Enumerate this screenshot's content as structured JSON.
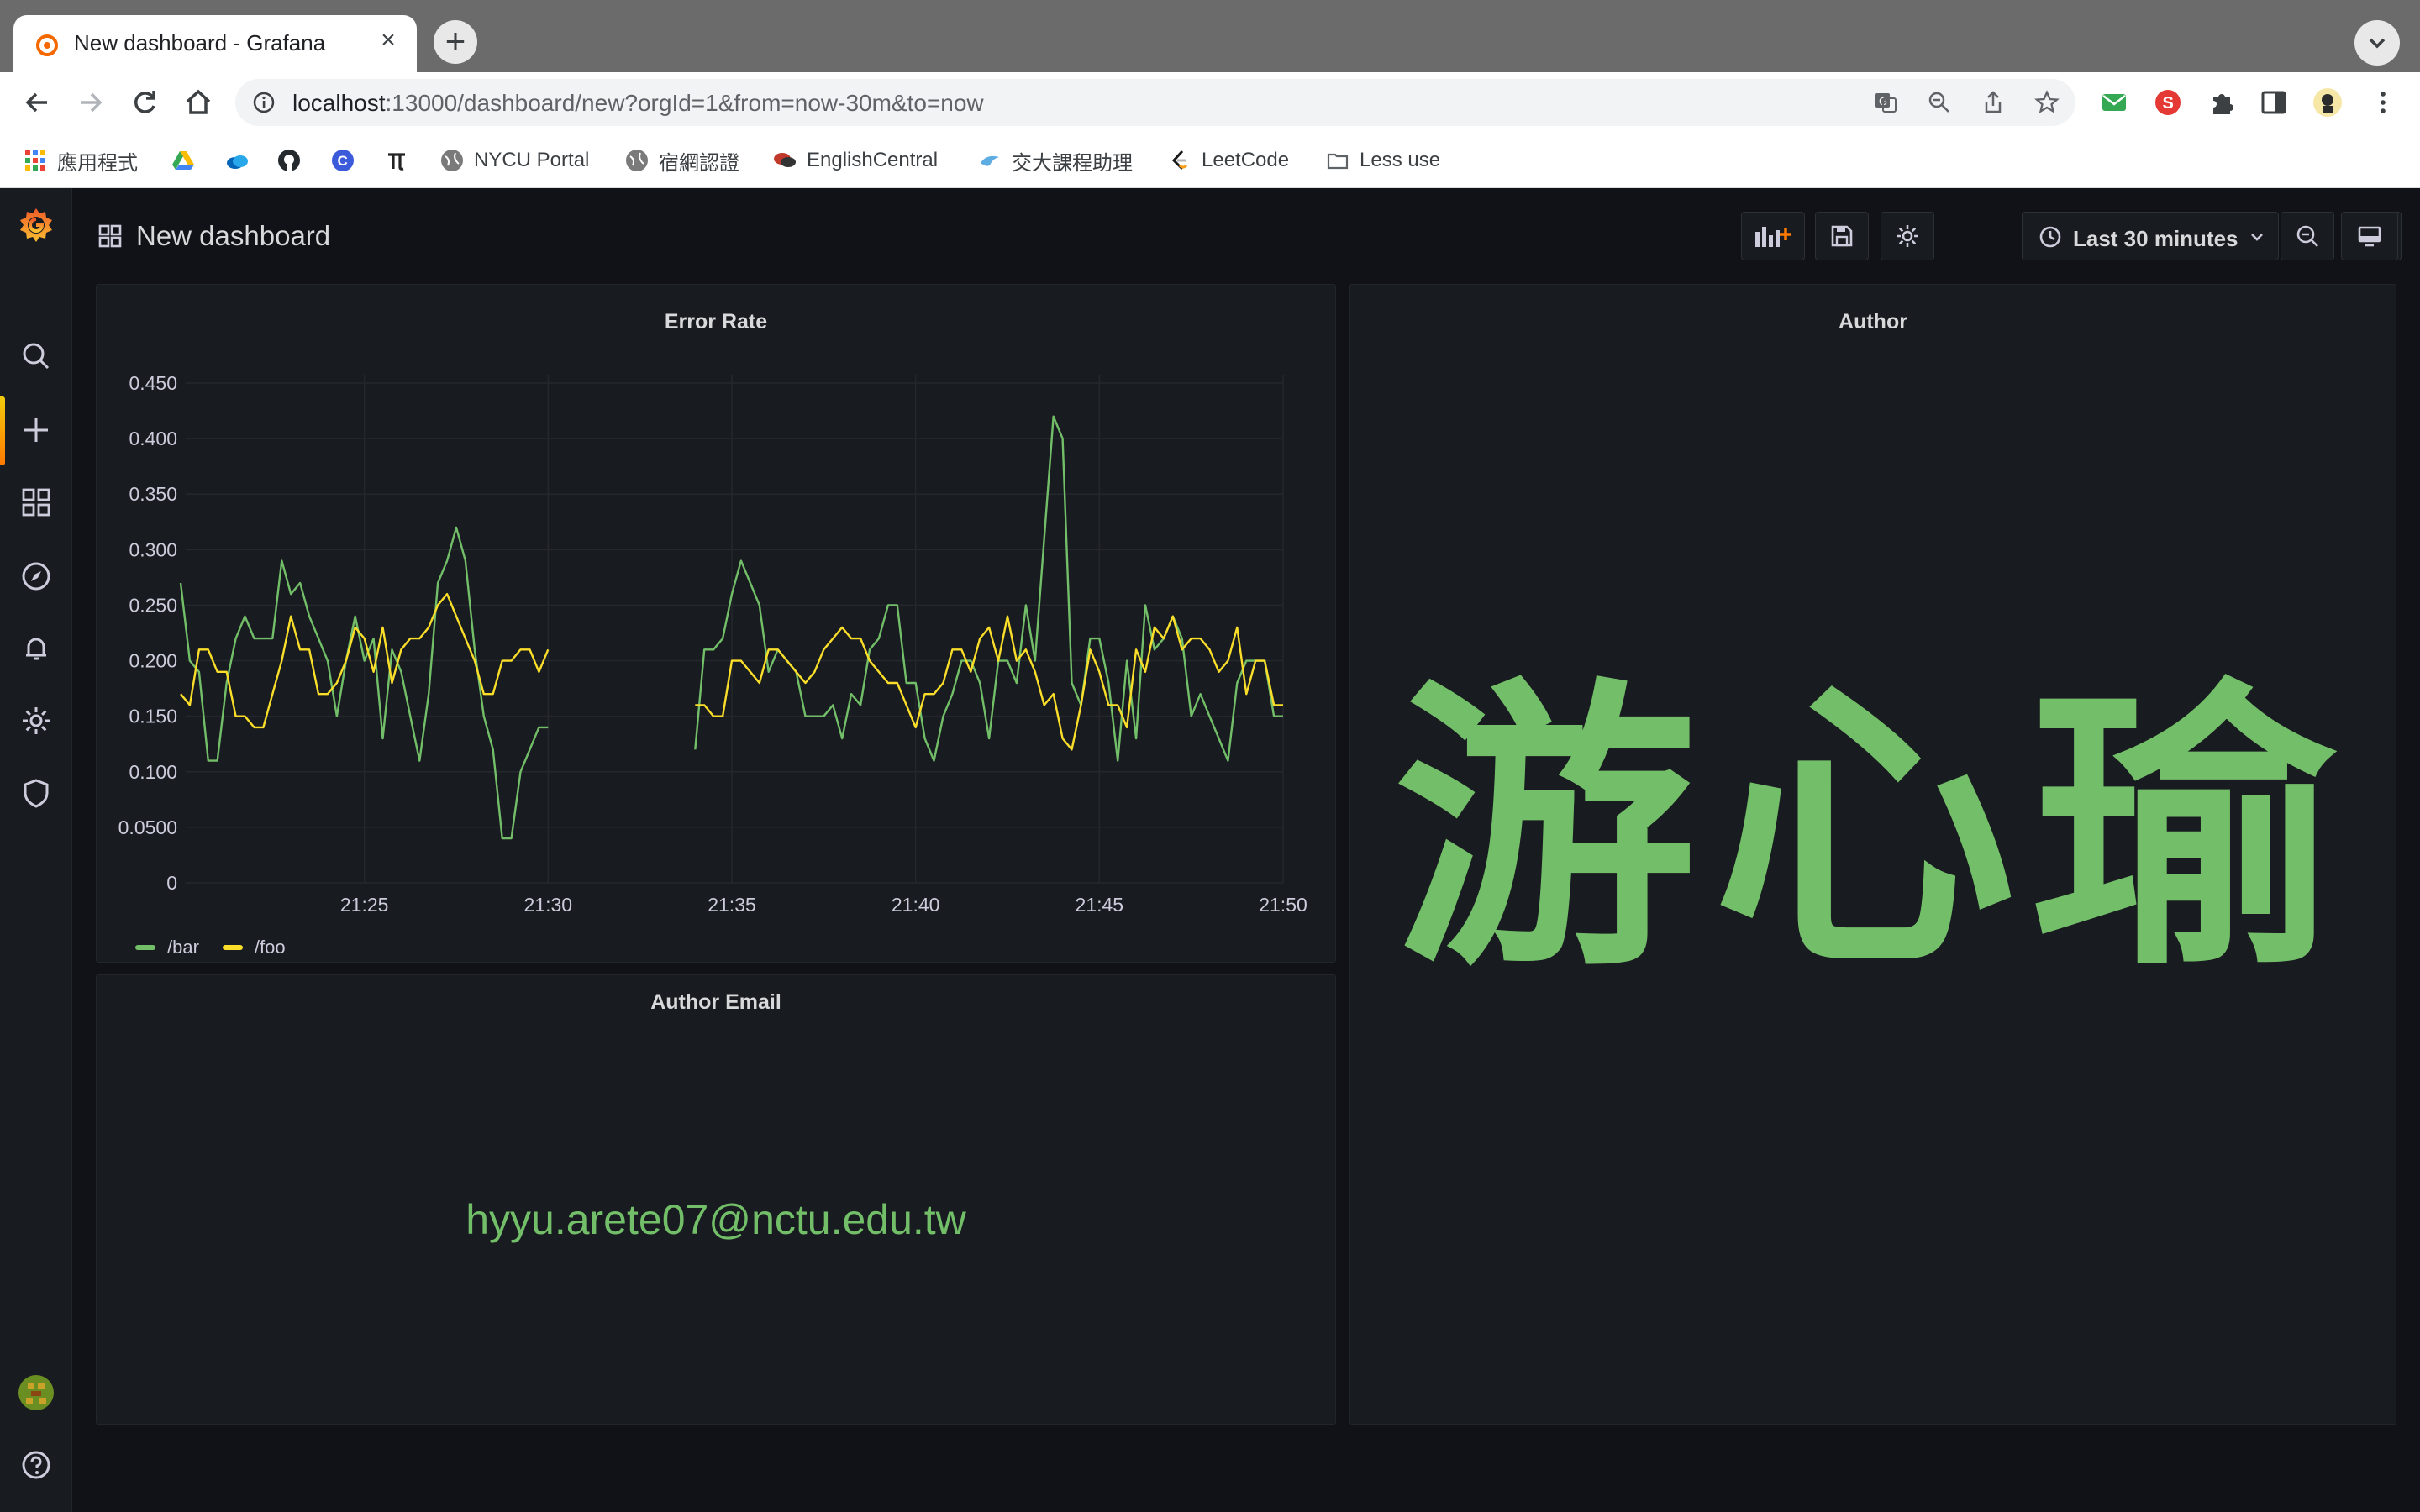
{
  "browser": {
    "tab_title": "New dashboard - Grafana",
    "url_host": "localhost",
    "url_rest": ":13000/dashboard/new?orgId=1&from=now-30m&to=now",
    "bookmarks": [
      {
        "label": "應用程式",
        "color": "#4285f4"
      },
      {
        "label": "",
        "color": "#34a853"
      },
      {
        "label": "",
        "color": "#4a90d9"
      },
      {
        "label": "",
        "color": "#24292e"
      },
      {
        "label": "",
        "color": "#3b5bdb"
      },
      {
        "label": "",
        "color": "#222222"
      },
      {
        "label": "NYCU Portal",
        "color": "#7a7a7a"
      },
      {
        "label": "宿網認證",
        "color": "#7a7a7a"
      },
      {
        "label": "EnglishCentral",
        "color": "#c0392b"
      },
      {
        "label": "交大課程助理",
        "color": "#5dade2"
      },
      {
        "label": "LeetCode",
        "color": "#f89f1b"
      },
      {
        "label": "Less use",
        "color": "#9aa0a6"
      }
    ]
  },
  "dashboard": {
    "title": "New dashboard",
    "time_range": "Last 30 minutes"
  },
  "panels": {
    "error_rate": {
      "title": "Error Rate"
    },
    "author": {
      "title": "Author",
      "value": "游心瑜"
    },
    "author_email": {
      "title": "Author Email",
      "value": "hyyu.arete07@nctu.edu.tw"
    }
  },
  "colors": {
    "bar_series": "#73bf69",
    "foo_series": "#fade2a",
    "accent": "#ff7a00"
  },
  "chart_data": {
    "type": "line",
    "title": "Error Rate",
    "xlabel": "",
    "ylabel": "",
    "x_ticks": [
      "21:25",
      "21:30",
      "21:35",
      "21:40",
      "21:45",
      "21:50"
    ],
    "y_ticks": [
      "0",
      "0.0500",
      "0.100",
      "0.150",
      "0.200",
      "0.250",
      "0.300",
      "0.350",
      "0.400",
      "0.450"
    ],
    "ylim": [
      0,
      0.45
    ],
    "xlim_minutes": [
      "21:20:00",
      "21:50:00"
    ],
    "grid": true,
    "legend_position": "bottom-left",
    "gap": [
      "21:30:00",
      "21:34:00"
    ],
    "series": [
      {
        "name": "/bar",
        "color": "#73bf69",
        "segments": [
          [
            [
              "21:20:00",
              0.27
            ],
            [
              "21:20:15",
              0.2
            ],
            [
              "21:20:30",
              0.19
            ],
            [
              "21:20:45",
              0.11
            ],
            [
              "21:21:00",
              0.11
            ],
            [
              "21:21:15",
              0.18
            ],
            [
              "21:21:30",
              0.22
            ],
            [
              "21:21:45",
              0.24
            ],
            [
              "21:22:00",
              0.22
            ],
            [
              "21:22:15",
              0.22
            ],
            [
              "21:22:30",
              0.22
            ],
            [
              "21:22:45",
              0.29
            ],
            [
              "21:23:00",
              0.26
            ],
            [
              "21:23:15",
              0.27
            ],
            [
              "21:23:30",
              0.24
            ],
            [
              "21:23:45",
              0.22
            ],
            [
              "21:24:00",
              0.2
            ],
            [
              "21:24:15",
              0.15
            ],
            [
              "21:24:30",
              0.2
            ],
            [
              "21:24:45",
              0.24
            ],
            [
              "21:25:00",
              0.2
            ],
            [
              "21:25:15",
              0.22
            ],
            [
              "21:25:30",
              0.13
            ],
            [
              "21:25:45",
              0.21
            ],
            [
              "21:26:00",
              0.19
            ],
            [
              "21:26:15",
              0.15
            ],
            [
              "21:26:30",
              0.11
            ],
            [
              "21:26:45",
              0.17
            ],
            [
              "21:27:00",
              0.27
            ],
            [
              "21:27:15",
              0.29
            ],
            [
              "21:27:30",
              0.32
            ],
            [
              "21:27:45",
              0.29
            ],
            [
              "21:28:00",
              0.21
            ],
            [
              "21:28:15",
              0.15
            ],
            [
              "21:28:30",
              0.12
            ],
            [
              "21:28:45",
              0.04
            ],
            [
              "21:29:00",
              0.04
            ],
            [
              "21:29:15",
              0.1
            ],
            [
              "21:29:30",
              0.12
            ],
            [
              "21:29:45",
              0.14
            ],
            [
              "21:30:00",
              0.14
            ]
          ],
          [
            [
              "21:34:00",
              0.12
            ],
            [
              "21:34:15",
              0.21
            ],
            [
              "21:34:30",
              0.21
            ],
            [
              "21:34:45",
              0.22
            ],
            [
              "21:35:00",
              0.26
            ],
            [
              "21:35:15",
              0.29
            ],
            [
              "21:35:30",
              0.27
            ],
            [
              "21:35:45",
              0.25
            ],
            [
              "21:36:00",
              0.19
            ],
            [
              "21:36:15",
              0.21
            ],
            [
              "21:36:30",
              0.2
            ],
            [
              "21:36:45",
              0.19
            ],
            [
              "21:37:00",
              0.15
            ],
            [
              "21:37:15",
              0.15
            ],
            [
              "21:37:30",
              0.15
            ],
            [
              "21:37:45",
              0.16
            ],
            [
              "21:38:00",
              0.13
            ],
            [
              "21:38:15",
              0.17
            ],
            [
              "21:38:30",
              0.16
            ],
            [
              "21:38:45",
              0.21
            ],
            [
              "21:39:00",
              0.22
            ],
            [
              "21:39:15",
              0.25
            ],
            [
              "21:39:30",
              0.25
            ],
            [
              "21:39:45",
              0.18
            ],
            [
              "21:40:00",
              0.18
            ],
            [
              "21:40:15",
              0.13
            ],
            [
              "21:40:30",
              0.11
            ],
            [
              "21:40:45",
              0.15
            ],
            [
              "21:41:00",
              0.17
            ],
            [
              "21:41:15",
              0.2
            ],
            [
              "21:41:30",
              0.2
            ],
            [
              "21:41:45",
              0.18
            ],
            [
              "21:42:00",
              0.13
            ],
            [
              "21:42:15",
              0.2
            ],
            [
              "21:42:30",
              0.2
            ],
            [
              "21:42:45",
              0.18
            ],
            [
              "21:43:00",
              0.25
            ],
            [
              "21:43:15",
              0.2
            ],
            [
              "21:43:30",
              0.31
            ],
            [
              "21:43:45",
              0.42
            ],
            [
              "21:44:00",
              0.4
            ],
            [
              "21:44:15",
              0.18
            ],
            [
              "21:44:30",
              0.16
            ],
            [
              "21:44:45",
              0.22
            ],
            [
              "21:45:00",
              0.22
            ],
            [
              "21:45:15",
              0.18
            ],
            [
              "21:45:30",
              0.11
            ],
            [
              "21:45:45",
              0.2
            ],
            [
              "21:46:00",
              0.13
            ],
            [
              "21:46:15",
              0.25
            ],
            [
              "21:46:30",
              0.21
            ],
            [
              "21:46:45",
              0.22
            ],
            [
              "21:47:00",
              0.24
            ],
            [
              "21:47:15",
              0.22
            ],
            [
              "21:47:30",
              0.15
            ],
            [
              "21:47:45",
              0.17
            ],
            [
              "21:48:00",
              0.15
            ],
            [
              "21:48:15",
              0.13
            ],
            [
              "21:48:30",
              0.11
            ],
            [
              "21:48:45",
              0.18
            ],
            [
              "21:49:00",
              0.2
            ],
            [
              "21:49:15",
              0.2
            ],
            [
              "21:49:30",
              0.2
            ],
            [
              "21:49:45",
              0.15
            ],
            [
              "21:50:00",
              0.15
            ]
          ]
        ]
      },
      {
        "name": "/foo",
        "color": "#fade2a",
        "segments": [
          [
            [
              "21:20:00",
              0.17
            ],
            [
              "21:20:15",
              0.16
            ],
            [
              "21:20:30",
              0.21
            ],
            [
              "21:20:45",
              0.21
            ],
            [
              "21:21:00",
              0.19
            ],
            [
              "21:21:15",
              0.19
            ],
            [
              "21:21:30",
              0.15
            ],
            [
              "21:21:45",
              0.15
            ],
            [
              "21:22:00",
              0.14
            ],
            [
              "21:22:15",
              0.14
            ],
            [
              "21:22:30",
              0.17
            ],
            [
              "21:22:45",
              0.2
            ],
            [
              "21:23:00",
              0.24
            ],
            [
              "21:23:15",
              0.21
            ],
            [
              "21:23:30",
              0.21
            ],
            [
              "21:23:45",
              0.17
            ],
            [
              "21:24:00",
              0.17
            ],
            [
              "21:24:15",
              0.18
            ],
            [
              "21:24:30",
              0.2
            ],
            [
              "21:24:45",
              0.23
            ],
            [
              "21:25:00",
              0.22
            ],
            [
              "21:25:15",
              0.19
            ],
            [
              "21:25:30",
              0.23
            ],
            [
              "21:25:45",
              0.18
            ],
            [
              "21:26:00",
              0.21
            ],
            [
              "21:26:15",
              0.22
            ],
            [
              "21:26:30",
              0.22
            ],
            [
              "21:26:45",
              0.23
            ],
            [
              "21:27:00",
              0.25
            ],
            [
              "21:27:15",
              0.26
            ],
            [
              "21:27:30",
              0.24
            ],
            [
              "21:27:45",
              0.22
            ],
            [
              "21:28:00",
              0.2
            ],
            [
              "21:28:15",
              0.17
            ],
            [
              "21:28:30",
              0.17
            ],
            [
              "21:28:45",
              0.2
            ],
            [
              "21:29:00",
              0.2
            ],
            [
              "21:29:15",
              0.21
            ],
            [
              "21:29:30",
              0.21
            ],
            [
              "21:29:45",
              0.19
            ],
            [
              "21:30:00",
              0.21
            ]
          ],
          [
            [
              "21:34:00",
              0.16
            ],
            [
              "21:34:15",
              0.16
            ],
            [
              "21:34:30",
              0.15
            ],
            [
              "21:34:45",
              0.15
            ],
            [
              "21:35:00",
              0.2
            ],
            [
              "21:35:15",
              0.2
            ],
            [
              "21:35:30",
              0.19
            ],
            [
              "21:35:45",
              0.18
            ],
            [
              "21:36:00",
              0.21
            ],
            [
              "21:36:15",
              0.21
            ],
            [
              "21:36:30",
              0.2
            ],
            [
              "21:36:45",
              0.19
            ],
            [
              "21:37:00",
              0.18
            ],
            [
              "21:37:15",
              0.19
            ],
            [
              "21:37:30",
              0.21
            ],
            [
              "21:37:45",
              0.22
            ],
            [
              "21:38:00",
              0.23
            ],
            [
              "21:38:15",
              0.22
            ],
            [
              "21:38:30",
              0.22
            ],
            [
              "21:38:45",
              0.2
            ],
            [
              "21:39:00",
              0.19
            ],
            [
              "21:39:15",
              0.18
            ],
            [
              "21:39:30",
              0.18
            ],
            [
              "21:39:45",
              0.16
            ],
            [
              "21:40:00",
              0.14
            ],
            [
              "21:40:15",
              0.17
            ],
            [
              "21:40:30",
              0.17
            ],
            [
              "21:40:45",
              0.18
            ],
            [
              "21:41:00",
              0.21
            ],
            [
              "21:41:15",
              0.21
            ],
            [
              "21:41:30",
              0.19
            ],
            [
              "21:41:45",
              0.22
            ],
            [
              "21:42:00",
              0.23
            ],
            [
              "21:42:15",
              0.2
            ],
            [
              "21:42:30",
              0.24
            ],
            [
              "21:42:45",
              0.2
            ],
            [
              "21:43:00",
              0.21
            ],
            [
              "21:43:15",
              0.19
            ],
            [
              "21:43:30",
              0.16
            ],
            [
              "21:43:45",
              0.17
            ],
            [
              "21:44:00",
              0.13
            ],
            [
              "21:44:15",
              0.12
            ],
            [
              "21:44:30",
              0.16
            ],
            [
              "21:44:45",
              0.21
            ],
            [
              "21:45:00",
              0.19
            ],
            [
              "21:45:15",
              0.16
            ],
            [
              "21:45:30",
              0.16
            ],
            [
              "21:45:45",
              0.14
            ],
            [
              "21:46:00",
              0.21
            ],
            [
              "21:46:15",
              0.19
            ],
            [
              "21:46:30",
              0.23
            ],
            [
              "21:46:45",
              0.22
            ],
            [
              "21:47:00",
              0.24
            ],
            [
              "21:47:15",
              0.21
            ],
            [
              "21:47:30",
              0.22
            ],
            [
              "21:47:45",
              0.22
            ],
            [
              "21:48:00",
              0.21
            ],
            [
              "21:48:15",
              0.19
            ],
            [
              "21:48:30",
              0.2
            ],
            [
              "21:48:45",
              0.23
            ],
            [
              "21:49:00",
              0.17
            ],
            [
              "21:49:15",
              0.2
            ],
            [
              "21:49:30",
              0.2
            ],
            [
              "21:49:45",
              0.16
            ],
            [
              "21:50:00",
              0.16
            ]
          ]
        ]
      }
    ]
  }
}
